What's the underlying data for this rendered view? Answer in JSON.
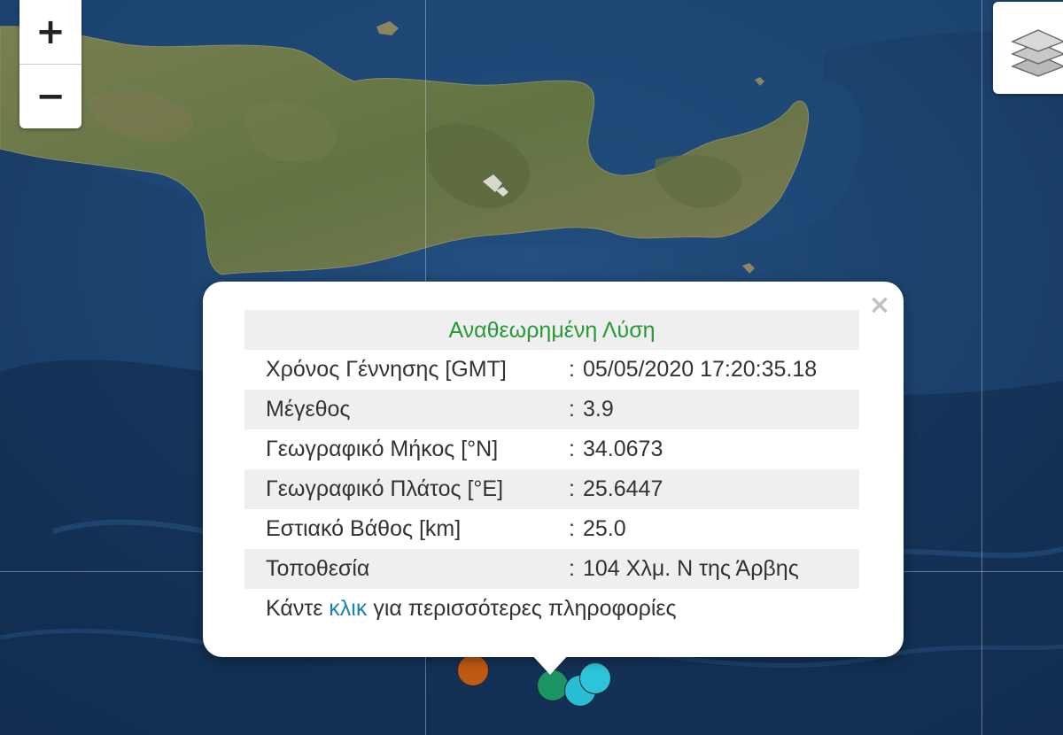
{
  "map": {
    "colors": {
      "sea_deep": "#15365c",
      "sea_shallow": "#2a5f96",
      "land": "#6b7a48"
    }
  },
  "zoom": {
    "in_label": "+",
    "out_label": "−"
  },
  "layers_control": {
    "icon": "layers-icon"
  },
  "markers": [
    {
      "color": "#c05a12"
    },
    {
      "color": "#1d9463"
    },
    {
      "color": "#27bdd4"
    },
    {
      "color": "#2bc4d8"
    }
  ],
  "popup": {
    "close_label": "×",
    "title": "Αναθεωρημένη Λύση",
    "title_color": "#259a37",
    "separator": ":",
    "rows": [
      {
        "label": "Χρόνος Γέννησης [GMT]",
        "value": "05/05/2020 17:20:35.18"
      },
      {
        "label": "Μέγεθος",
        "value": "3.9"
      },
      {
        "label": "Γεωγραφικό Μήκος [°N]",
        "value": "34.0673"
      },
      {
        "label": "Γεωγραφικό Πλάτος [°E]",
        "value": "25.6447"
      },
      {
        "label": "Εστιακό Βάθος [km]",
        "value": "25.0"
      },
      {
        "label": "Τοποθεσία",
        "value": "104 Χλμ. Ν της Άρβης"
      }
    ],
    "footer": {
      "before": "Κάντε",
      "link": "κλικ",
      "after": "για περισσότερες πληροφορίες"
    }
  }
}
